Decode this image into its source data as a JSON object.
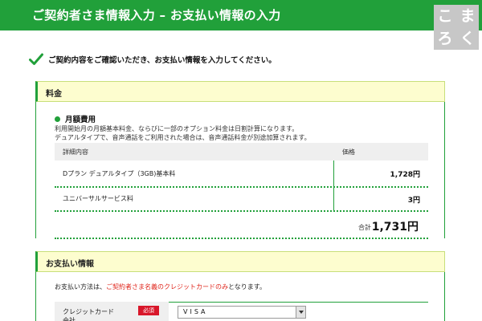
{
  "header": {
    "title": "ご契約者さま情報入力 – お支払い情報の入力"
  },
  "logo": {
    "chars": [
      "こ",
      "ま",
      "ろ",
      "く"
    ]
  },
  "intro": {
    "text": "ご契約内容をご確認いただき、お支払い情報を入力してください。"
  },
  "fee_section": {
    "heading": "料金",
    "subheading": "月額費用",
    "note_line1": "利用開始月の月額基本料金、ならびに一部のオプション料金は日割計算になります。",
    "note_line2": "デュアルタイプで、音声通話をご利用された場合は、音声通話料金が別途加算されます。",
    "table": {
      "col_detail": "詳細内容",
      "col_price": "価格",
      "rows": [
        {
          "label": "Dプラン デュアルタイプ（3GB)基本料",
          "price": "1,728円"
        },
        {
          "label": "ユニバーサルサービス料",
          "price": "3円"
        }
      ],
      "total_label": "合計",
      "total_value": "1,731円"
    }
  },
  "payment_section": {
    "heading": "お支払い情報",
    "note_prefix": "お支払い方法は、",
    "note_highlight": "ご契約者さま名義のクレジットカードのみ",
    "note_suffix": "となります。",
    "form": {
      "label_line1": "クレジットカード",
      "label_line2": "会社",
      "required_badge": "必須",
      "selected_value": "VISA"
    }
  },
  "colors": {
    "accent": "#21a03a",
    "panel_bg": "#fdfdcf",
    "required": "#d8172a",
    "highlight": "#e0281e"
  }
}
